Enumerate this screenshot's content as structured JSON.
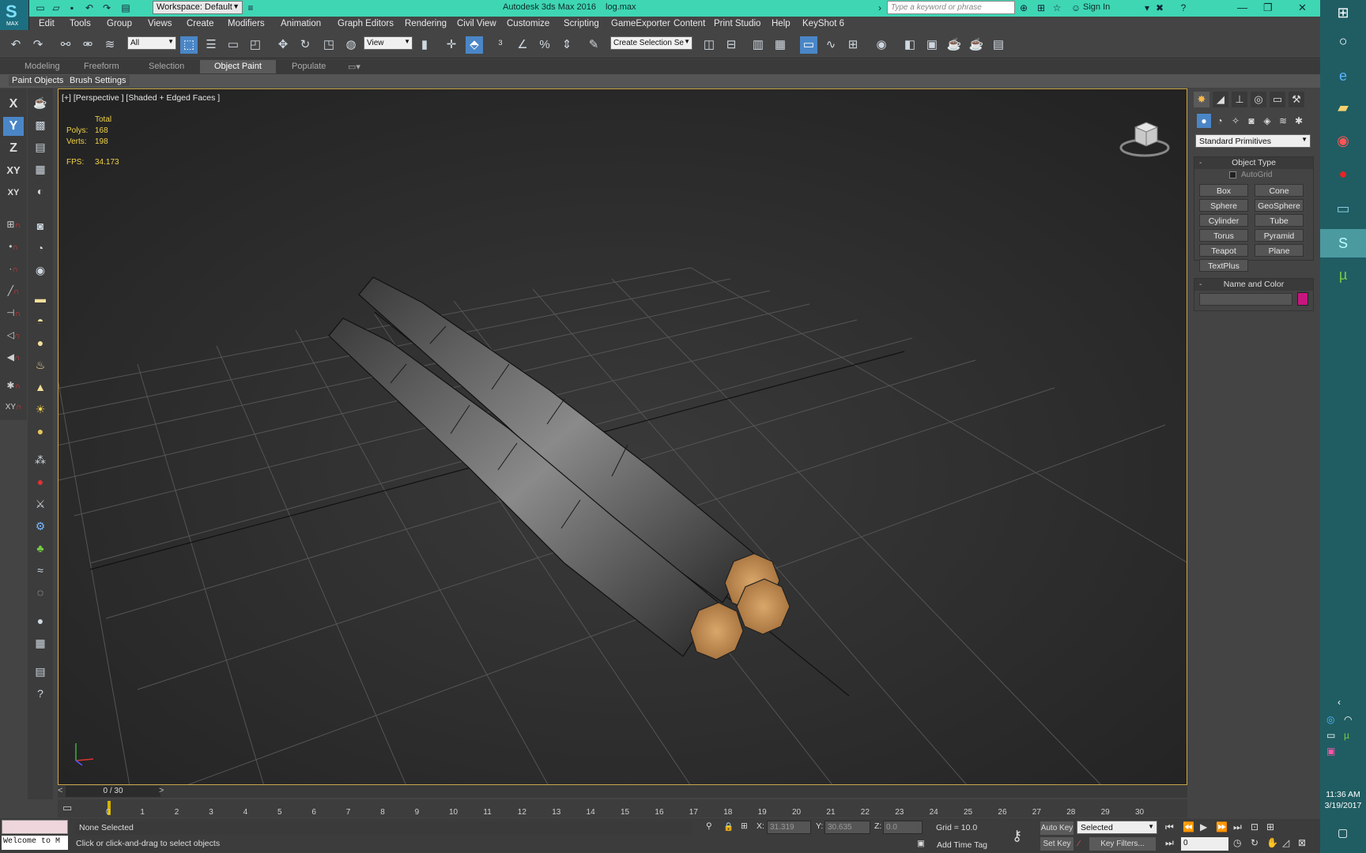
{
  "titlebar": {
    "app_title": "Autodesk 3ds Max 2016",
    "file_name": "log.max",
    "workspace": "Workspace: Default",
    "search_placeholder": "Type a keyword or phrase",
    "sign_in": "Sign In",
    "logo_text": "MAX"
  },
  "menubar": [
    "Edit",
    "Tools",
    "Group",
    "Views",
    "Create",
    "Modifiers",
    "Animation",
    "Graph Editors",
    "Rendering",
    "Civil View",
    "Customize",
    "Scripting",
    "GameExporter",
    "Content",
    "Print Studio",
    "Help",
    "KeyShot 6"
  ],
  "toolbar": {
    "selection_filter": "All",
    "ref_coord": "View",
    "named_selection": "Create Selection Se"
  },
  "ribbon": {
    "tabs": [
      "Modeling",
      "Freeform",
      "Selection",
      "Object Paint",
      "Populate"
    ],
    "active_tab": "Object Paint",
    "subtabs": [
      "Paint Objects",
      "Brush Settings"
    ]
  },
  "axis_constraints": [
    "X",
    "Y",
    "Z",
    "XY",
    "XY"
  ],
  "viewport": {
    "label": "[+] [Perspective ] [Shaded + Edged Faces ]",
    "stats": {
      "header": "Total",
      "polys_label": "Polys:",
      "polys": "168",
      "verts_label": "Verts:",
      "verts": "198",
      "fps_label": "FPS:",
      "fps": "34.173"
    }
  },
  "timeline": {
    "slider": "0 / 30",
    "ticks": [
      "0",
      "1",
      "2",
      "3",
      "4",
      "5",
      "6",
      "7",
      "8",
      "9",
      "10",
      "11",
      "12",
      "13",
      "14",
      "15",
      "16",
      "17",
      "18",
      "19",
      "20",
      "21",
      "22",
      "23",
      "24",
      "25",
      "26",
      "27",
      "28",
      "29",
      "30"
    ]
  },
  "status": {
    "listener_cmd": "Welcome to M",
    "selection": "None Selected",
    "prompt": "Click or click-and-drag to select objects",
    "x_label": "X:",
    "x": "31.319",
    "y_label": "Y:",
    "y": "30.635",
    "z_label": "Z:",
    "z": "0.0",
    "grid": "Grid = 10.0",
    "add_time_tag": "Add Time Tag",
    "auto_key": "Auto Key",
    "selected_set": "Selected",
    "set_key": "Set Key",
    "key_filters": "Key Filters...",
    "frame": "0"
  },
  "command_panel": {
    "category": "Standard Primitives",
    "object_type_title": "Object Type",
    "autogrid": "AutoGrid",
    "primitives": [
      "Box",
      "Cone",
      "Sphere",
      "GeoSphere",
      "Cylinder",
      "Tube",
      "Torus",
      "Pyramid",
      "Teapot",
      "Plane",
      "TextPlus"
    ],
    "name_color_title": "Name and Color",
    "object_color": "#c8167f"
  },
  "system": {
    "time": "11:36 AM",
    "date": "3/19/2017"
  }
}
